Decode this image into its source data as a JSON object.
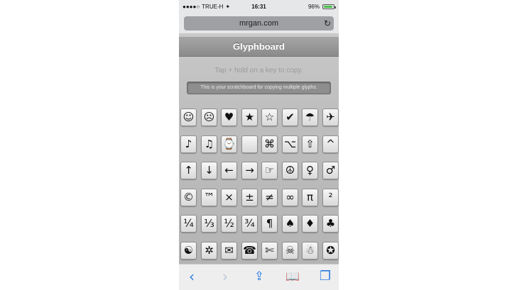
{
  "status": {
    "signal": "●●●●○",
    "carrier": "TRUE-H",
    "wifi": "✦",
    "time": "16:31",
    "battery_pct": "96%",
    "battery_level": 0.96
  },
  "browser": {
    "url": "mrgan.com",
    "reload": "↻"
  },
  "page": {
    "title": "Glyphboard",
    "hint": "Tap + hold on a key to copy.",
    "scratchpad_placeholder": "This is your scratchboard for copying multiple glyphs."
  },
  "keys": [
    [
      "☺",
      "☹",
      "♥",
      "★",
      "☆",
      "✔",
      "☂",
      "✈"
    ],
    [
      "♪",
      "♫",
      "⌚",
      "",
      "⌘",
      "⌥",
      "⇧",
      "^"
    ],
    [
      "↑",
      "↓",
      "←",
      "→",
      "☞",
      "☮",
      "♀",
      "♂"
    ],
    [
      "©",
      "™",
      "×",
      "±",
      "≠",
      "∞",
      "π",
      "²"
    ],
    [
      "¼",
      "⅓",
      "½",
      "¾",
      "¶",
      "♠",
      "♦",
      "♣"
    ],
    [
      "☯",
      "✲",
      "✉",
      "☎",
      "✄",
      "☠",
      "☃",
      "✪"
    ]
  ],
  "toolbar": {
    "back": "‹",
    "forward": "›",
    "share": "⇪",
    "bookmarks": "📖",
    "tabs": "❐"
  },
  "colors": {
    "accent": "#2a7ae0",
    "battery": "#46c04a"
  }
}
